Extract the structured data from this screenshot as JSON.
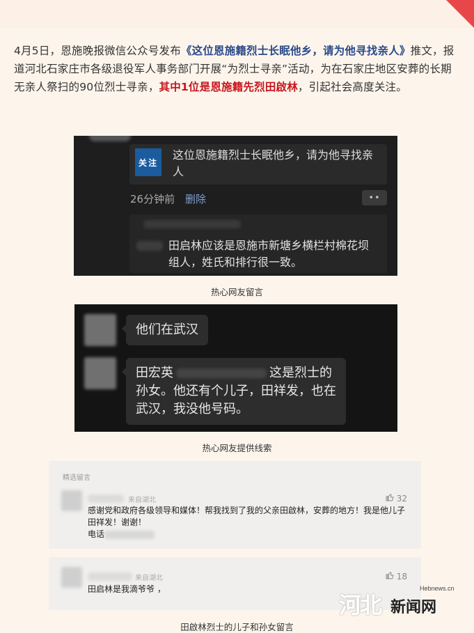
{
  "intro": {
    "part1": "4月5日，恩施晚报微信公众号发布",
    "link": "《这位恩施籍烈士长眠他乡，请为他寻找亲人》",
    "part2": "推文，报道河北石家庄市各级退役军人事务部门开展“为烈士寻亲”活动，为在石家庄地区安葬的长期无亲人祭扫的90位烈士寻亲，",
    "highlight": "其中1位是恩施籍先烈田啟林",
    "part3": "，引起社会高度关注。"
  },
  "shot1": {
    "card_badge": "关注",
    "card_title": "这位恩施籍烈士长眠他乡，请为他寻找亲人",
    "time": "26分钟前",
    "delete": "删除",
    "more": "••",
    "reply": "田启林应该是恩施市新塘乡横栏村棉花坝组人，姓氏和排行很一致。"
  },
  "caption1": "热心网友留言",
  "shot2": {
    "msg1": "他们在武汉",
    "msg2_name": "田宏英",
    "msg2_a": "这是烈士",
    "msg2_b": "的孙女。他还有个儿子，田祥发，也在武汉，我没他号码。"
  },
  "caption2": "热心网友提供线索",
  "comments": {
    "header": "精选留言",
    "c1": {
      "from": "来自湖北",
      "likes": "32",
      "text": "感谢党和政府各级领导和媒体！帮我找到了我的父亲田啟林，安葬的地方！我是他儿子田祥发！谢谢！",
      "phone_label": "电话"
    },
    "c2": {
      "from": "来自湖北",
      "likes": "18",
      "text": "田启林是我滴爷爷 ，"
    }
  },
  "caption3": "田啟林烈士的儿子和孙女留言",
  "logo": {
    "site": "Hebnews.cn",
    "name": "新闻网",
    "mark": "河北"
  }
}
